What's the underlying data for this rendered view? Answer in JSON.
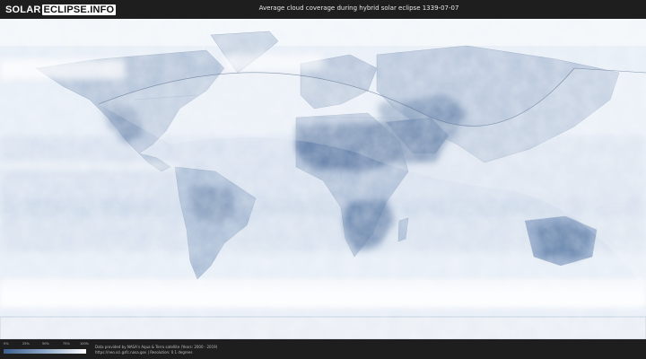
{
  "header": {
    "logo_part1": "SOLAR",
    "logo_part2": "ECLIPSE.INFO",
    "title": "Average cloud coverage during hybrid solar eclipse 1339-07-07"
  },
  "map": {
    "map_type": "equirectangular world cloud coverage",
    "colors": {
      "ocean_base": "#e8eef6",
      "clear_sky": "#4d6e9b",
      "cloud": "#ffffff",
      "eclipse_band": "#dce6f2"
    }
  },
  "footer": {
    "legend_ticks": [
      "0%",
      "25%",
      "50%",
      "75%",
      "100%"
    ],
    "credit_line1": "Data provided by NASA's Aqua & Terra satellite (Years: 2000 - 2019)",
    "credit_line2": "https://neo.sci.gsfc.nasa.gov | Resolution: 0.1 degrees"
  }
}
